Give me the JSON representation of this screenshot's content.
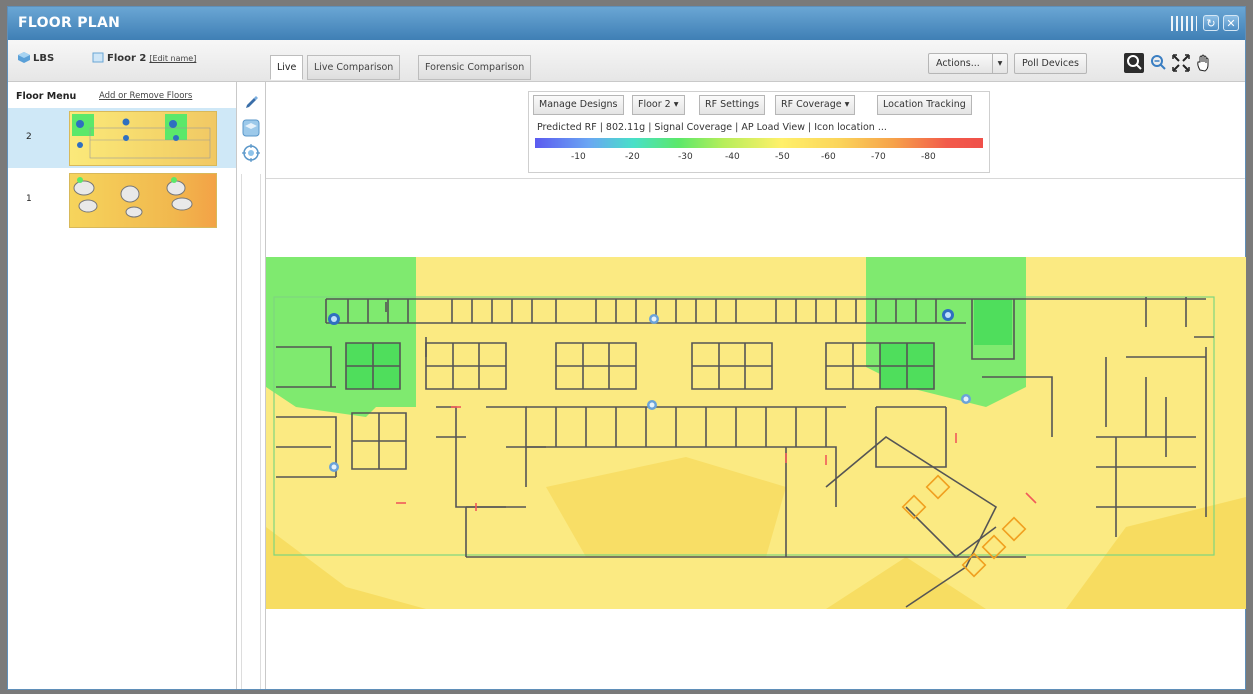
{
  "window": {
    "title": "FLOOR PLAN"
  },
  "toolbar": {
    "crumb_site": "LBS",
    "crumb_floor": "Floor 2",
    "crumb_edit": "[Edit name]",
    "tabs": [
      {
        "label": "Live",
        "active": true
      },
      {
        "label": "Live Comparison",
        "active": false
      },
      {
        "label": "Forensic Comparison",
        "active": false
      }
    ],
    "actions_label": "Actions...",
    "actions_dropdown": "▾",
    "poll_label": "Poll Devices"
  },
  "floor_menu": {
    "title": "Floor Menu",
    "link": "Add or Remove Floors",
    "floors": [
      {
        "number": "2",
        "selected": true
      },
      {
        "number": "1",
        "selected": false
      }
    ]
  },
  "control_panel": {
    "buttons": {
      "manage_designs": "Manage Designs",
      "floor_select": "Floor 2 ▾",
      "rf_settings": "RF Settings",
      "rf_coverage": "RF Coverage ▾",
      "location_tracking": "Location Tracking"
    },
    "status_line": "Predicted RF  |  802.11g  |  Signal Coverage  |  AP Load View  |  Icon location ...",
    "legend_ticks": [
      "-10",
      "-20",
      "-30",
      "-40",
      "-50",
      "-60",
      "-70",
      "-80"
    ]
  },
  "colors": {
    "title_bar": "#3f7fb5",
    "coverage_strong": "#5be86a",
    "coverage_medium": "#fbe97a",
    "coverage_weak": "#f7d95a",
    "wall": "#555555",
    "outline": "#7ed67e"
  },
  "icons": {
    "site": "cube-icon",
    "floor": "floor-icon",
    "draw": "pencil-icon",
    "layers": "layers-icon",
    "locate": "target-icon",
    "zoom_in": "zoom-in-icon",
    "zoom_out": "zoom-out-icon",
    "fit": "fit-screen-icon",
    "pan": "hand-icon",
    "refresh": "refresh-icon",
    "close": "close-icon"
  }
}
